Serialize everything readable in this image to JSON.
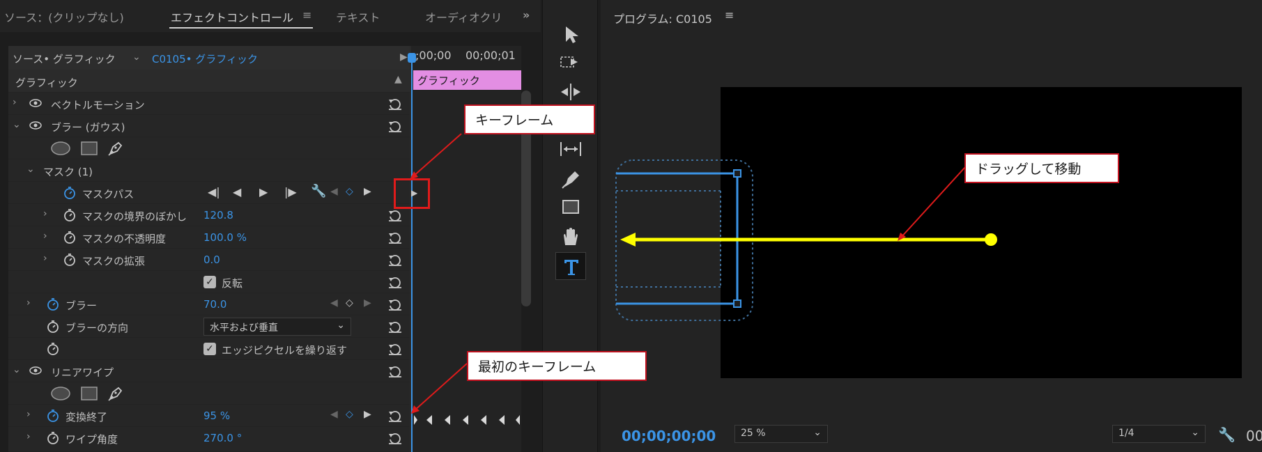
{
  "tabs": [
    {
      "label": "ソース：(クリップなし)"
    },
    {
      "label": "エフェクトコントロール"
    },
    {
      "label": "テキスト"
    },
    {
      "label": "オーディオクリ"
    }
  ],
  "source": {
    "primary": "ソース• グラフィック",
    "secondary": "C0105• グラフィック"
  },
  "timeline": {
    "t0": ";00;00",
    "t1": "00;00;01",
    "clip_label": "グラフィック"
  },
  "effects": {
    "section": "グラフィック",
    "vector_motion": "ベクトルモーション",
    "blur_gauss": "ブラー (ガウス)",
    "mask_group": "マスク (1)",
    "mask_path": "マスクパス",
    "mask_feather": {
      "label": "マスクの境界のぼかし",
      "value": "120.8"
    },
    "mask_opacity": {
      "label": "マスクの不透明度",
      "value": "100.0 %"
    },
    "mask_expansion": {
      "label": "マスクの拡張",
      "value": "0.0"
    },
    "inverted": "反転",
    "blur": {
      "label": "ブラー",
      "value": "70.0"
    },
    "blur_direction": {
      "label": "ブラーの方向",
      "value": "水平および垂直"
    },
    "repeat_edge": "エッジピクセルを繰り返す",
    "linear_wipe": "リニアワイプ",
    "transition_end": {
      "label": "変換終了",
      "value": "95 %"
    },
    "wipe_angle": {
      "label": "ワイプ角度",
      "value": "270.0 °"
    }
  },
  "program": {
    "title": "プログラム: C0105",
    "timecode": "00;00;00;00",
    "zoom": "25 %",
    "resolution": "1/4",
    "extra": "00"
  },
  "annotations": {
    "keyframe": "キーフレーム",
    "drag": "ドラッグして移動",
    "first_keyframe": "最初のキーフレーム"
  },
  "colors": {
    "accent": "#3b94e6",
    "arrow": "#ffff00",
    "annotation_border": "#c1121f",
    "clip": "#e38ee3"
  }
}
